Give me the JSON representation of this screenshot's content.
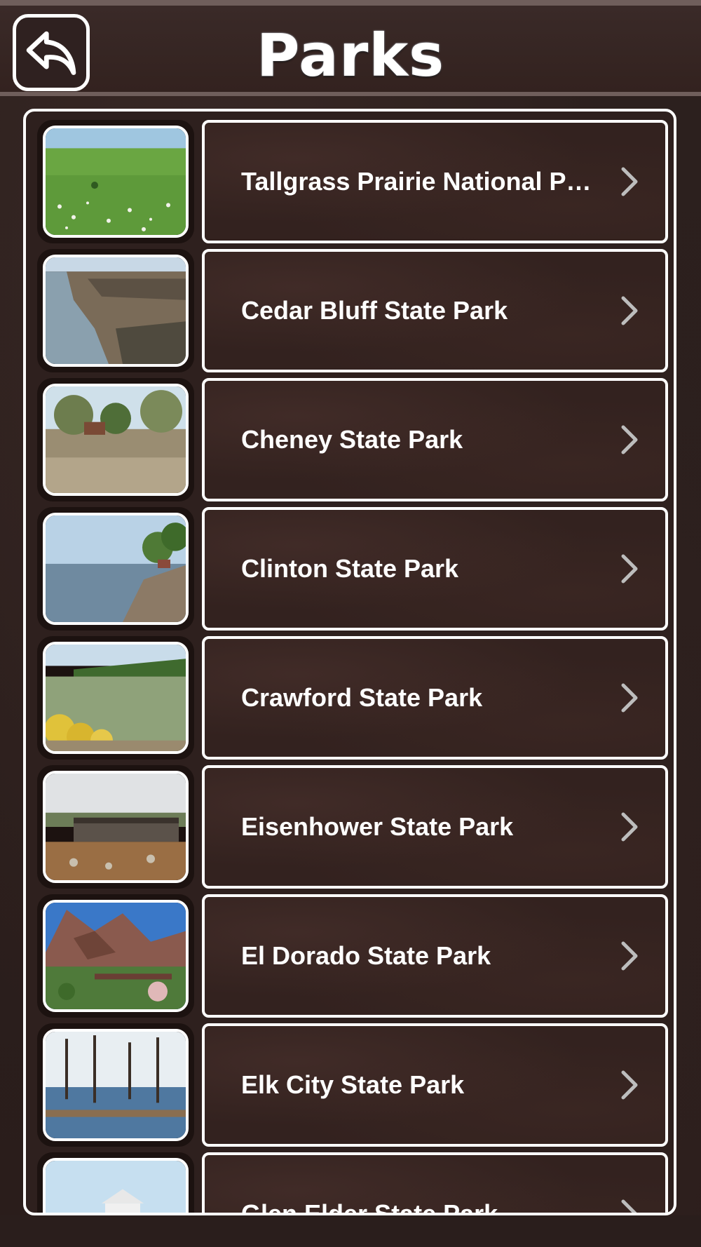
{
  "header": {
    "title": "Parks",
    "back_icon": "back-arrow-icon"
  },
  "items": [
    {
      "label": "Tallgrass Prairie National Preserve",
      "thumb": "prairie"
    },
    {
      "label": "Cedar Bluff State Park",
      "thumb": "bluff"
    },
    {
      "label": "Cheney State Park",
      "thumb": "cheney"
    },
    {
      "label": "Clinton State Park",
      "thumb": "clinton"
    },
    {
      "label": "Crawford State Park",
      "thumb": "crawford"
    },
    {
      "label": "Eisenhower State Park",
      "thumb": "eisenhower"
    },
    {
      "label": "El Dorado State Park",
      "thumb": "eldorado"
    },
    {
      "label": "Elk City State Park",
      "thumb": "elkcity"
    },
    {
      "label": "Glen Elder State Park",
      "thumb": "glenelder"
    }
  ],
  "colors": {
    "background": "#2a1e1c",
    "header": "#3a2a28",
    "border": "#ffffff",
    "text": "#ffffff",
    "chevron": "#bdbdbd"
  }
}
